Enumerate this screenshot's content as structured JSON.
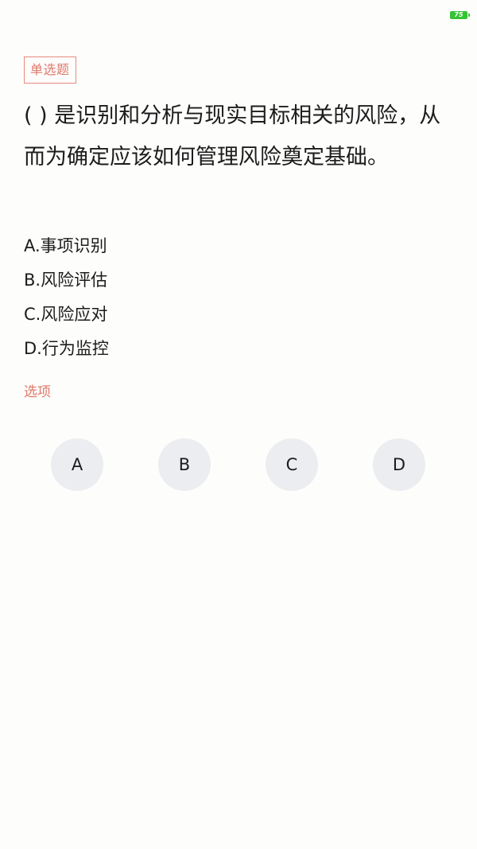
{
  "status_bar": {
    "battery_level": "75",
    "battery_color": "#35c234"
  },
  "question": {
    "type_tag": "单选题",
    "text": "( ) 是识别和分析与现实目标相关的风险，从而为确定应该如何管理风险奠定基础。",
    "options": [
      "A.事项识别",
      "B.风险评估",
      "C.风险应对",
      "D.行为监控"
    ]
  },
  "answer": {
    "section_label": "选项",
    "choices": [
      "A",
      "B",
      "C",
      "D"
    ]
  },
  "colors": {
    "accent": "#e0786a",
    "choice_bg": "#ecedf0",
    "background": "#fdfdfb"
  }
}
